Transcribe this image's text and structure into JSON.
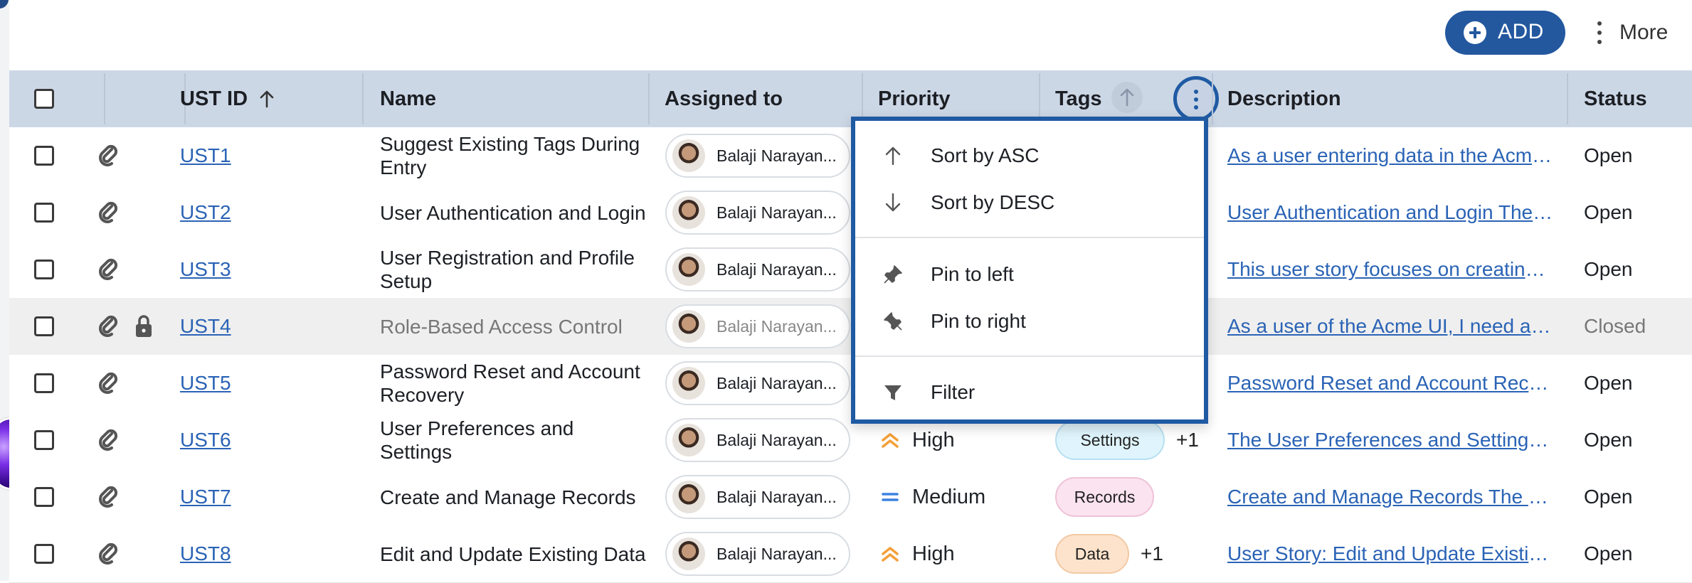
{
  "toolbar": {
    "add_label": "ADD",
    "more_label": "More"
  },
  "columns": [
    {
      "label": ""
    },
    {
      "label": ""
    },
    {
      "label": "UST ID"
    },
    {
      "label": "Name"
    },
    {
      "label": "Assigned to"
    },
    {
      "label": "Priority"
    },
    {
      "label": "Tags"
    },
    {
      "label": "Description"
    },
    {
      "label": "Status"
    }
  ],
  "rows": [
    {
      "id": "UST1",
      "name": "Suggest Existing Tags During Entry",
      "assignee": "Balaji Narayan...",
      "priority": "",
      "tags": [],
      "tags_more": "",
      "description": "As a user entering data in the Acme ...",
      "status": "Open",
      "locked": false
    },
    {
      "id": "UST2",
      "name": "User Authentication and Login",
      "assignee": "Balaji Narayan...",
      "priority": "",
      "tags": [],
      "tags_more": "",
      "description": "User Authentication and Login The ...",
      "status": "Open",
      "locked": false
    },
    {
      "id": "UST3",
      "name": "User Registration and Profile Setup",
      "assignee": "Balaji Narayan...",
      "priority": "",
      "tags": [],
      "tags_more": "",
      "description": "This user story focuses on creating ...",
      "status": "Open",
      "locked": false
    },
    {
      "id": "UST4",
      "name": "Role-Based Access Control",
      "assignee": "Balaji Narayan...",
      "priority": "",
      "tags": [],
      "tags_more": "",
      "description": "As a user of the Acme UI, I need a ro...",
      "status": "Closed",
      "locked": true
    },
    {
      "id": "UST5",
      "name": "Password Reset and Account Recovery",
      "assignee": "Balaji Narayan...",
      "priority": "",
      "tags": [],
      "tags_more": "",
      "description": "Password Reset and Account Recov...",
      "status": "Open",
      "locked": false
    },
    {
      "id": "UST6",
      "name": "User Preferences and Settings",
      "assignee": "Balaji Narayan...",
      "priority": "High",
      "tags": [
        {
          "label": "Settings",
          "bg": "#dff4fc",
          "border": "#b6e0f2"
        }
      ],
      "tags_more": "+1",
      "description": "The User Preferences and Settings f...",
      "status": "Open",
      "locked": false
    },
    {
      "id": "UST7",
      "name": "Create and Manage Records",
      "assignee": "Balaji Narayan...",
      "priority": "Medium",
      "tags": [
        {
          "label": "Records",
          "bg": "#fbe3ef",
          "border": "#efc2d8"
        }
      ],
      "tags_more": "",
      "description": "Create and Manage Records The us...",
      "status": "Open",
      "locked": false
    },
    {
      "id": "UST8",
      "name": "Edit and Update Existing Data",
      "assignee": "Balaji Narayan...",
      "priority": "High",
      "tags": [
        {
          "label": "Data",
          "bg": "#fde3cb",
          "border": "#f2c9a4"
        }
      ],
      "tags_more": "+1",
      "description": "User Story: Edit and Update Existin...",
      "status": "Open",
      "locked": false
    }
  ],
  "column_menu": {
    "items": [
      {
        "label": "Sort by ASC",
        "icon": "arrow-up-icon"
      },
      {
        "label": "Sort by DESC",
        "icon": "arrow-down-icon"
      },
      {
        "label": "Pin to left",
        "icon": "pin-left-icon"
      },
      {
        "label": "Pin to right",
        "icon": "pin-right-icon"
      },
      {
        "label": "Filter",
        "icon": "filter-icon"
      }
    ]
  },
  "colors": {
    "accent": "#23589f",
    "header_bg": "#ccd7e6",
    "link": "#2a63b5",
    "priority_high": "#f4a03a",
    "priority_medium": "#3b82e0"
  }
}
